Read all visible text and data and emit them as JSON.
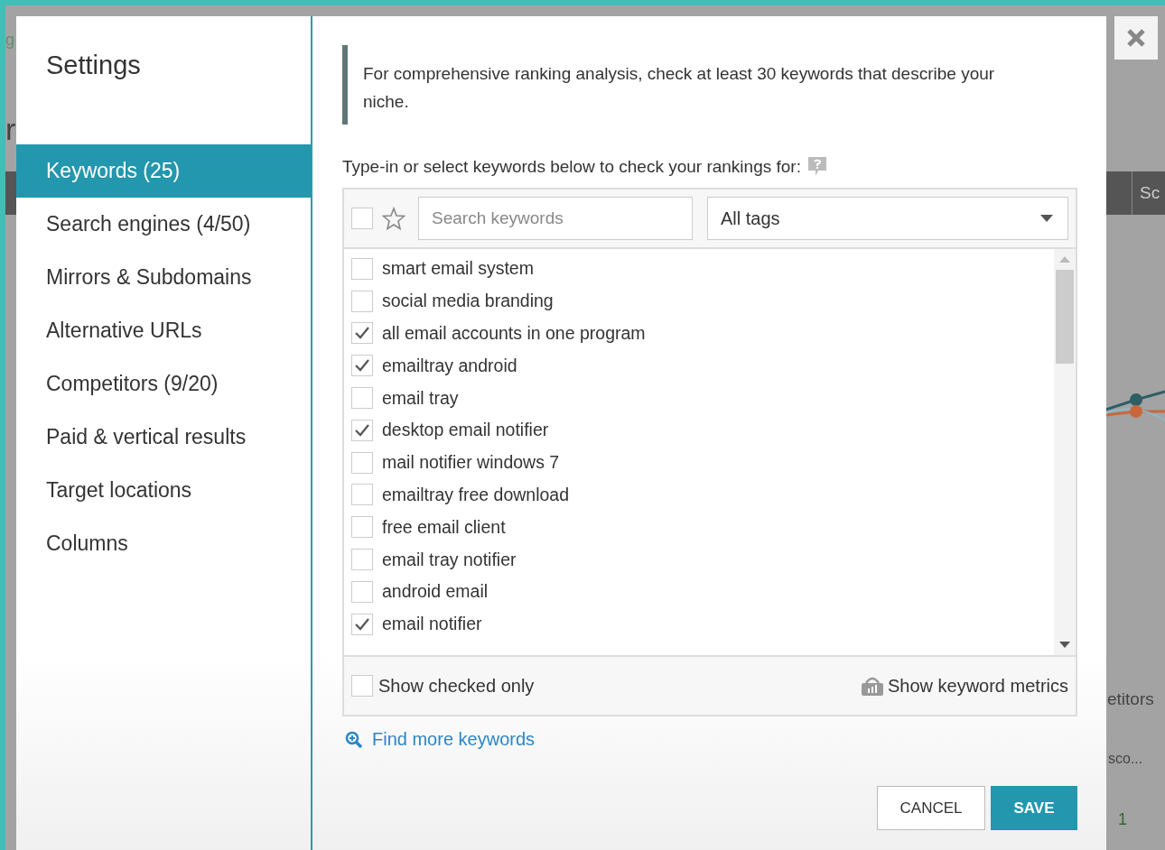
{
  "background": {
    "left_texts": [
      {
        "text": "g",
        "kind": "link"
      },
      {
        "text": "r",
        "kind": "heading"
      }
    ],
    "tab_label": "Sc",
    "section_label": "etitors",
    "column_label": "sco...",
    "value": "1"
  },
  "dialog": {
    "title": "Settings",
    "nav": [
      {
        "label": "Keywords (25)",
        "selected": true
      },
      {
        "label": "Search engines (4/50)",
        "selected": false
      },
      {
        "label": "Mirrors & Subdomains",
        "selected": false
      },
      {
        "label": "Alternative URLs",
        "selected": false
      },
      {
        "label": "Competitors (9/20)",
        "selected": false
      },
      {
        "label": "Paid & vertical results",
        "selected": false
      },
      {
        "label": "Target locations",
        "selected": false
      },
      {
        "label": "Columns",
        "selected": false
      }
    ],
    "notice": "For comprehensive ranking analysis, check at least 30 keywords that describe your niche.",
    "instruction": "Type-in or select keywords below to check your rankings for:",
    "select_all": {
      "checked": false
    },
    "search": {
      "placeholder": "Search keywords"
    },
    "tag_filter": {
      "value": "All tags"
    },
    "keywords": [
      {
        "text": "smart email system",
        "checked": false
      },
      {
        "text": "social media branding",
        "checked": false
      },
      {
        "text": "all email accounts in one program",
        "checked": true
      },
      {
        "text": "emailtray android",
        "checked": true
      },
      {
        "text": "email tray",
        "checked": false
      },
      {
        "text": "desktop email notifier",
        "checked": true
      },
      {
        "text": "mail notifier windows 7",
        "checked": false
      },
      {
        "text": "emailtray free download",
        "checked": false
      },
      {
        "text": "free email client",
        "checked": false
      },
      {
        "text": "email tray notifier",
        "checked": false
      },
      {
        "text": "android email",
        "checked": false
      },
      {
        "text": "email notifier",
        "checked": true
      }
    ],
    "show_checked_only": {
      "label": "Show checked only",
      "checked": false
    },
    "metrics_link": "Show keyword metrics",
    "find_more_link": "Find more keywords",
    "buttons": [
      {
        "label": "CANCEL",
        "kind": "secondary"
      },
      {
        "label": "SAVE",
        "kind": "primary"
      }
    ]
  }
}
